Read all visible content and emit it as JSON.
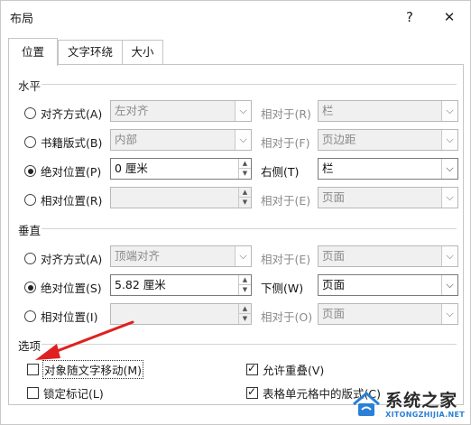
{
  "window": {
    "title": "布局",
    "help_icon": "?",
    "close_icon": "✕"
  },
  "tabs": [
    {
      "label": "位置",
      "active": true
    },
    {
      "label": "文字环绕",
      "active": false
    },
    {
      "label": "大小",
      "active": false
    }
  ],
  "horizontal": {
    "heading": "水平",
    "align": {
      "label": "对齐方式(A)",
      "value": "左对齐",
      "relative_label": "相对于(R)",
      "relative_value": "栏"
    },
    "book": {
      "label": "书籍版式(B)",
      "value": "内部",
      "relative_label": "相对于(F)",
      "relative_value": "页边距"
    },
    "absolute": {
      "label": "绝对位置(P)",
      "value": "0 厘米",
      "relative_label": "右侧(T)",
      "relative_value": "栏"
    },
    "relative": {
      "label": "相对位置(R)",
      "value": "",
      "relative_label": "相对于(E)",
      "relative_value": "页面"
    }
  },
  "vertical": {
    "heading": "垂直",
    "align": {
      "label": "对齐方式(A)",
      "value": "顶端对齐",
      "relative_label": "相对于(E)",
      "relative_value": "页面"
    },
    "absolute": {
      "label": "绝对位置(S)",
      "value": "5.82 厘米",
      "relative_label": "下侧(W)",
      "relative_value": "页面"
    },
    "relative": {
      "label": "相对位置(I)",
      "value": "",
      "relative_label": "相对于(O)",
      "relative_value": "页面"
    }
  },
  "options": {
    "heading": "选项",
    "move_with_text": {
      "label": "对象随文字移动(M)",
      "checked": false
    },
    "lock_anchor": {
      "label": "锁定标记(L)",
      "checked": false
    },
    "allow_overlap": {
      "label": "允许重叠(V)",
      "checked": true
    },
    "layout_in_cell": {
      "label": "表格单元格中的版式(C)",
      "checked": true
    }
  },
  "watermark": {
    "text": "系统之家",
    "url": "XITONGZHIJIA.NET"
  },
  "colors": {
    "annotation_arrow": "#e02020",
    "watermark_blue": "#2a7fd6"
  }
}
